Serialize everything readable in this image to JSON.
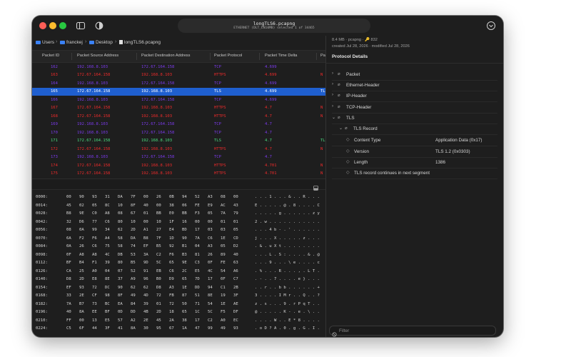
{
  "colors": {
    "tcp": "#7c3aed",
    "https": "#ef2b2b",
    "tls": "#4ade80",
    "selected_row": "#1f5fcf",
    "folder": "#3b82f6"
  },
  "window": {
    "title": "longTLS6.pcapng",
    "subtitle": "ETHERNET (DLT_EN10MB) selected 1 of 34465"
  },
  "breadcrumb": [
    "Users",
    "franckej",
    "Desktop",
    "longTLS6.pcapng"
  ],
  "columns": [
    "Packet ID",
    "Packet Source Address",
    "Packet Destination Address",
    "Packet Protocol",
    "Packet Time Delta",
    "Pa"
  ],
  "packets": [
    {
      "id": "162",
      "src": "192.168.8.103",
      "dst": "172.67.164.158",
      "proto": "TCP",
      "delta": "4.699",
      "last": "",
      "kind": "tcp"
    },
    {
      "id": "163",
      "src": "172.67.164.158",
      "dst": "192.168.8.103",
      "proto": "HTTPS",
      "delta": "4.699",
      "last": "N",
      "kind": "https"
    },
    {
      "id": "164",
      "src": "192.168.8.103",
      "dst": "172.67.164.158",
      "proto": "TCP",
      "delta": "4.699",
      "last": "",
      "kind": "tcp"
    },
    {
      "id": "165",
      "src": "172.67.164.158",
      "dst": "192.168.8.103",
      "proto": "TLS",
      "delta": "4.699",
      "last": "TL",
      "kind": "selected"
    },
    {
      "id": "166",
      "src": "192.168.8.103",
      "dst": "172.67.164.158",
      "proto": "TCP",
      "delta": "4.699",
      "last": "",
      "kind": "tcp"
    },
    {
      "id": "167",
      "src": "172.67.164.158",
      "dst": "192.168.8.103",
      "proto": "HTTPS",
      "delta": "4.7",
      "last": "N",
      "kind": "https"
    },
    {
      "id": "168",
      "src": "172.67.164.158",
      "dst": "192.168.8.103",
      "proto": "HTTPS",
      "delta": "4.7",
      "last": "N",
      "kind": "https"
    },
    {
      "id": "169",
      "src": "192.168.8.103",
      "dst": "172.67.164.158",
      "proto": "TCP",
      "delta": "4.7",
      "last": "",
      "kind": "tcp"
    },
    {
      "id": "170",
      "src": "192.168.8.103",
      "dst": "172.67.164.158",
      "proto": "TCP",
      "delta": "4.7",
      "last": "",
      "kind": "tcp"
    },
    {
      "id": "171",
      "src": "172.67.164.158",
      "dst": "192.168.8.103",
      "proto": "TLS",
      "delta": "4.7",
      "last": "TL",
      "kind": "tls"
    },
    {
      "id": "172",
      "src": "172.67.164.158",
      "dst": "192.168.8.103",
      "proto": "HTTPS",
      "delta": "4.7",
      "last": "N",
      "kind": "https"
    },
    {
      "id": "173",
      "src": "192.168.8.103",
      "dst": "172.67.164.158",
      "proto": "TCP",
      "delta": "4.7",
      "last": "",
      "kind": "tcp"
    },
    {
      "id": "174",
      "src": "172.67.164.158",
      "dst": "192.168.8.103",
      "proto": "HTTPS",
      "delta": "4.701",
      "last": "N",
      "kind": "https"
    },
    {
      "id": "175",
      "src": "172.67.164.158",
      "dst": "192.168.8.103",
      "proto": "HTTPS",
      "delta": "4.701",
      "last": "N",
      "kind": "https"
    }
  ],
  "hex_rows": [
    {
      "off": "0000:",
      "bytes": [
        "00",
        "90",
        "93",
        "31",
        "DA",
        "7F",
        "00",
        "26",
        "0B",
        "94",
        "52",
        "A3",
        "08",
        "00"
      ],
      "ascii": ". . . 1 . . . & . . R . . ."
    },
    {
      "off": "0014:",
      "bytes": [
        "45",
        "02",
        "05",
        "8C",
        "10",
        "8F",
        "40",
        "00",
        "38",
        "06",
        "FE",
        "E9",
        "AC",
        "43"
      ],
      "ascii": "E . . . . . @ . 8 . . . . C"
    },
    {
      "off": "0028:",
      "bytes": [
        "B8",
        "9E",
        "C0",
        "A8",
        "08",
        "67",
        "01",
        "BB",
        "E0",
        "BB",
        "F3",
        "05",
        "7A",
        "79"
      ],
      "ascii": ". . . . . g . . . . . . z y"
    },
    {
      "off": "0042:",
      "bytes": [
        "32",
        "D6",
        "77",
        "C6",
        "80",
        "10",
        "00",
        "10",
        "1F",
        "16",
        "00",
        "00",
        "01",
        "01"
      ],
      "ascii": "2 . w . . . . . . . . . . ."
    },
    {
      "off": "0056:",
      "bytes": [
        "08",
        "0A",
        "99",
        "34",
        "62",
        "2D",
        "A1",
        "27",
        "E4",
        "BD",
        "17",
        "03",
        "03",
        "05"
      ],
      "ascii": ". . . 4 b - . ' . . . . . ."
    },
    {
      "off": "0070:",
      "bytes": [
        "6A",
        "F2",
        "F6",
        "A4",
        "58",
        "DA",
        "B8",
        "7F",
        "1D",
        "90",
        "7A",
        "C6",
        "1E",
        "CD"
      ],
      "ascii": "j . . . X . . . . . z . . ."
    },
    {
      "off": "0084:",
      "bytes": [
        "0A",
        "26",
        "C6",
        "75",
        "58",
        "74",
        "EF",
        "B5",
        "92",
        "B1",
        "04",
        "A3",
        "05",
        "D2"
      ],
      "ascii": ". & . u X t . . . . . . . ."
    },
    {
      "off": "0098:",
      "bytes": [
        "0F",
        "A8",
        "A8",
        "4C",
        "DB",
        "53",
        "3A",
        "C2",
        "F6",
        "B3",
        "81",
        "26",
        "89",
        "40"
      ],
      "ascii": ". . . L . S : . . . . & . @"
    },
    {
      "off": "0112:",
      "bytes": [
        "BF",
        "B4",
        "F1",
        "39",
        "80",
        "B5",
        "9D",
        "5C",
        "65",
        "9E",
        "C3",
        "0F",
        "FE",
        "63"
      ],
      "ascii": ". . . 9 . . . \\ e . . . . c"
    },
    {
      "off": "0126:",
      "bytes": [
        "CA",
        "25",
        "A0",
        "04",
        "07",
        "52",
        "91",
        "EB",
        "C6",
        "2C",
        "E5",
        "4C",
        "54",
        "A6"
      ],
      "ascii": ". % . . . R . . . , . L T ."
    },
    {
      "off": "0140:",
      "bytes": [
        "D8",
        "2D",
        "E8",
        "8E",
        "37",
        "A9",
        "96",
        "B0",
        "D9",
        "65",
        "7D",
        "17",
        "0F",
        "C7"
      ],
      "ascii": ". - . . 7 . . . . e } . . ."
    },
    {
      "off": "0154:",
      "bytes": [
        "EF",
        "93",
        "72",
        "DC",
        "90",
        "62",
        "62",
        "D8",
        "A3",
        "1E",
        "DD",
        "94",
        "C1",
        "2B"
      ],
      "ascii": ". . r . . b b . . . . . . +"
    },
    {
      "off": "0168:",
      "bytes": [
        "33",
        "2E",
        "CF",
        "98",
        "8F",
        "49",
        "4D",
        "72",
        "FB",
        "87",
        "51",
        "8E",
        "19",
        "3F"
      ],
      "ascii": "3 . . . . I M r . . Q . . ?"
    },
    {
      "off": "0182:",
      "bytes": [
        "7A",
        "B7",
        "73",
        "BC",
        "EA",
        "84",
        "39",
        "01",
        "72",
        "50",
        "71",
        "54",
        "1E",
        "AE"
      ],
      "ascii": "z . s . . . 9 . r P q T . ."
    },
    {
      "off": "0196:",
      "bytes": [
        "40",
        "8A",
        "EE",
        "BF",
        "0D",
        "DD",
        "4B",
        "2D",
        "18",
        "65",
        "1C",
        "5C",
        "F5",
        "DF"
      ],
      "ascii": "@ . . . . . K - . e . \\ . ."
    },
    {
      "off": "0210:",
      "bytes": [
        "FF",
        "00",
        "13",
        "E5",
        "57",
        "A2",
        "2E",
        "45",
        "2A",
        "38",
        "17",
        "C2",
        "A0",
        "EC"
      ],
      "ascii": ". . . . W . . E * 8 . . . ."
    },
    {
      "off": "0224:",
      "bytes": [
        "C5",
        "6F",
        "44",
        "3F",
        "41",
        "8A",
        "30",
        "95",
        "67",
        "1A",
        "47",
        "99",
        "49",
        "93"
      ],
      "ascii": ". o D ? A . 0 . g . G . I ."
    }
  ],
  "file_info": {
    "line1": "8.4 MB · pcapng · 🔑 832",
    "line2": "created Jul 28, 2026 · modified Jul 28, 2026"
  },
  "details_title": "Protocol Details",
  "tree": [
    {
      "label": "Packet",
      "value": "",
      "level": 0,
      "chevron": "›"
    },
    {
      "label": "Ethernet-Header",
      "value": "",
      "level": 0,
      "chevron": "›"
    },
    {
      "label": "IP-Header",
      "value": "",
      "level": 0,
      "chevron": "›"
    },
    {
      "label": "TCP-Header",
      "value": "",
      "level": 0,
      "chevron": "›"
    },
    {
      "label": "TLS",
      "value": "",
      "level": 0,
      "chevron": "⌄"
    },
    {
      "label": "TLS Record",
      "value": "",
      "level": 1,
      "chevron": "⌄"
    },
    {
      "label": "Content Type",
      "value": "Application Data (0x17)",
      "level": 2,
      "chevron": ""
    },
    {
      "label": "Version",
      "value": "TLS 1.2 (0x0303)",
      "level": 2,
      "chevron": ""
    },
    {
      "label": "Length",
      "value": "1386",
      "level": 2,
      "chevron": ""
    },
    {
      "label": "TLS record continues in next segment",
      "value": "",
      "level": 2,
      "chevron": ""
    }
  ],
  "filter": {
    "placeholder": "Filter",
    "value": ""
  },
  "icons": {
    "sidebar_toggle": "sidebar-icon",
    "appearance": "contrast-icon",
    "chevron": "chevron-icon",
    "attachment": "paperclip-icon",
    "tag": "tag-icon",
    "search": "search-icon"
  }
}
